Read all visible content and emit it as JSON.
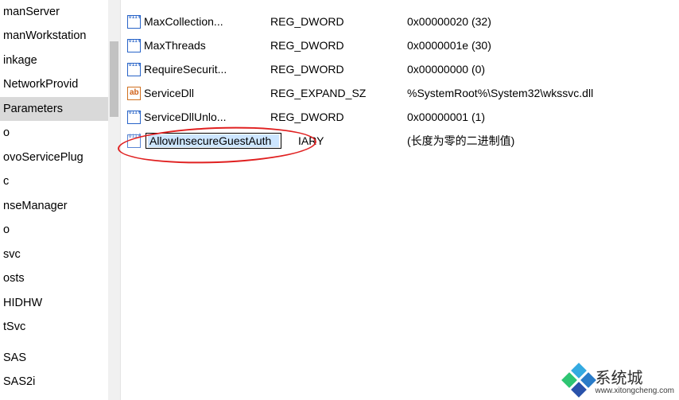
{
  "tree": {
    "items": [
      {
        "label": "manServer",
        "selected": false
      },
      {
        "label": "manWorkstation",
        "selected": false
      },
      {
        "label": "inkage",
        "selected": false
      },
      {
        "label": "NetworkProvid",
        "selected": false
      },
      {
        "label": "Parameters",
        "selected": true
      },
      {
        "label": "o",
        "selected": false
      },
      {
        "label": "ovoServicePlug",
        "selected": false
      },
      {
        "label": "c",
        "selected": false
      },
      {
        "label": "nseManager",
        "selected": false
      },
      {
        "label": "o",
        "selected": false
      },
      {
        "label": "svc",
        "selected": false
      },
      {
        "label": "osts",
        "selected": false
      },
      {
        "label": "HIDHW",
        "selected": false
      },
      {
        "label": "tSvc",
        "selected": false
      },
      {
        "label": "",
        "selected": false
      },
      {
        "label": "SAS",
        "selected": false
      },
      {
        "label": "SAS2i",
        "selected": false
      }
    ]
  },
  "values": [
    {
      "icon": "bin",
      "name": "MaxCollection...",
      "type": "REG_DWORD",
      "data": "0x00000020 (32)"
    },
    {
      "icon": "bin",
      "name": "MaxThreads",
      "type": "REG_DWORD",
      "data": "0x0000001e (30)"
    },
    {
      "icon": "bin",
      "name": "RequireSecurit...",
      "type": "REG_DWORD",
      "data": "0x00000000 (0)"
    },
    {
      "icon": "sz",
      "name": "ServiceDll",
      "type": "REG_EXPAND_SZ",
      "data": "%SystemRoot%\\System32\\wkssvc.dll"
    },
    {
      "icon": "bin",
      "name": "ServiceDllUnlo...",
      "type": "REG_DWORD",
      "data": "0x00000001 (1)"
    },
    {
      "icon": "bin-dim",
      "name_editing": true,
      "name": "AllowInsecureGuestAuth",
      "type_suffix": "IARY",
      "data": "(长度为零的二进制值)"
    }
  ],
  "watermark": {
    "brand": "系统城",
    "url": "www.xitongcheng.com"
  }
}
